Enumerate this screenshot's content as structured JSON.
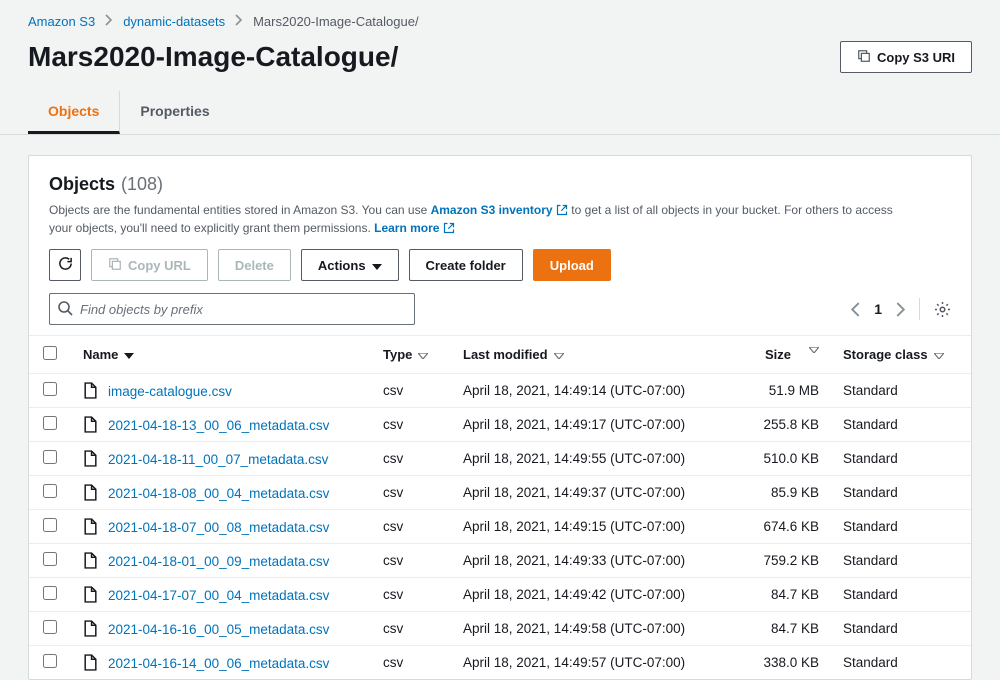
{
  "breadcrumb": {
    "root": "Amazon S3",
    "bucket": "dynamic-datasets",
    "prefix": "Mars2020-Image-Catalogue/"
  },
  "page_title": "Mars2020-Image-Catalogue/",
  "buttons": {
    "copy_s3_uri": "Copy S3 URI",
    "refresh": "Refresh",
    "copy_url": "Copy URL",
    "delete": "Delete",
    "actions": "Actions",
    "create_folder": "Create folder",
    "upload": "Upload"
  },
  "tabs": {
    "objects": "Objects",
    "properties": "Properties"
  },
  "panel": {
    "title": "Objects",
    "count": "(108)",
    "desc_pre": "Objects are the fundamental entities stored in Amazon S3. You can use ",
    "inventory_link": "Amazon S3 inventory",
    "desc_mid": " to get a list of all objects in your bucket. For others to access your objects, you'll need to explicitly grant them permissions. ",
    "learn_more": "Learn more"
  },
  "search": {
    "placeholder": "Find objects by prefix"
  },
  "pager": {
    "page": "1"
  },
  "table": {
    "headers": {
      "name": "Name",
      "type": "Type",
      "last_modified": "Last modified",
      "size": "Size",
      "storage_class": "Storage class"
    },
    "rows": [
      {
        "name": "image-catalogue.csv",
        "type": "csv",
        "last_modified": "April 18, 2021, 14:49:14 (UTC-07:00)",
        "size": "51.9 MB",
        "storage_class": "Standard"
      },
      {
        "name": "2021-04-18-13_00_06_metadata.csv",
        "type": "csv",
        "last_modified": "April 18, 2021, 14:49:17 (UTC-07:00)",
        "size": "255.8 KB",
        "storage_class": "Standard"
      },
      {
        "name": "2021-04-18-11_00_07_metadata.csv",
        "type": "csv",
        "last_modified": "April 18, 2021, 14:49:55 (UTC-07:00)",
        "size": "510.0 KB",
        "storage_class": "Standard"
      },
      {
        "name": "2021-04-18-08_00_04_metadata.csv",
        "type": "csv",
        "last_modified": "April 18, 2021, 14:49:37 (UTC-07:00)",
        "size": "85.9 KB",
        "storage_class": "Standard"
      },
      {
        "name": "2021-04-18-07_00_08_metadata.csv",
        "type": "csv",
        "last_modified": "April 18, 2021, 14:49:15 (UTC-07:00)",
        "size": "674.6 KB",
        "storage_class": "Standard"
      },
      {
        "name": "2021-04-18-01_00_09_metadata.csv",
        "type": "csv",
        "last_modified": "April 18, 2021, 14:49:33 (UTC-07:00)",
        "size": "759.2 KB",
        "storage_class": "Standard"
      },
      {
        "name": "2021-04-17-07_00_04_metadata.csv",
        "type": "csv",
        "last_modified": "April 18, 2021, 14:49:42 (UTC-07:00)",
        "size": "84.7 KB",
        "storage_class": "Standard"
      },
      {
        "name": "2021-04-16-16_00_05_metadata.csv",
        "type": "csv",
        "last_modified": "April 18, 2021, 14:49:58 (UTC-07:00)",
        "size": "84.7 KB",
        "storage_class": "Standard"
      },
      {
        "name": "2021-04-16-14_00_06_metadata.csv",
        "type": "csv",
        "last_modified": "April 18, 2021, 14:49:57 (UTC-07:00)",
        "size": "338.0 KB",
        "storage_class": "Standard"
      }
    ]
  }
}
